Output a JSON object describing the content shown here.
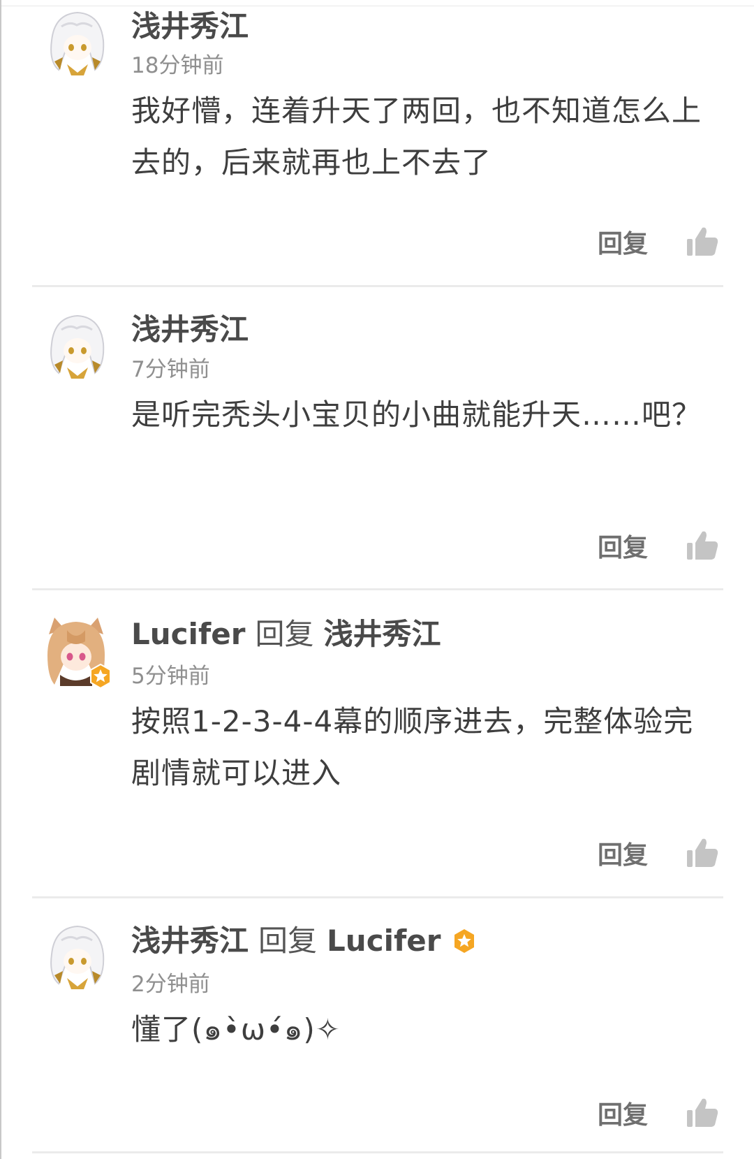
{
  "reply_button_label": "回复",
  "reply_connector": "回复",
  "colors": {
    "badge": "#f5a623",
    "like_icon": "#c4c4c4",
    "divider": "#ebebeb"
  },
  "comments": [
    {
      "username": "浅井秀江",
      "time": "18分钟前",
      "text": "我好懵，连着升天了两回，也不知道怎么上去的，后来就再也上不去了",
      "avatar": "white-haired-anime-girl-avatar"
    },
    {
      "username": "浅井秀江",
      "time": "7分钟前",
      "text": "是听完秃头小宝贝的小曲就能升天……吧？",
      "avatar": "white-haired-anime-girl-avatar"
    },
    {
      "username": "Lucifer",
      "reply_to": "浅井秀江",
      "time": "5分钟前",
      "text": "按照1-2-3-4-4幕的顺序进去，完整体验完剧情就可以进入",
      "avatar": "brown-haired-anime-girl-avatar",
      "avatar_badge": "star-badge-icon"
    },
    {
      "username": "浅井秀江",
      "reply_to": "Lucifer",
      "reply_to_badge": "star-badge-icon",
      "time": "2分钟前",
      "text": "懂了(๑•̀ω•́๑)✧",
      "avatar": "white-haired-anime-girl-avatar"
    }
  ]
}
